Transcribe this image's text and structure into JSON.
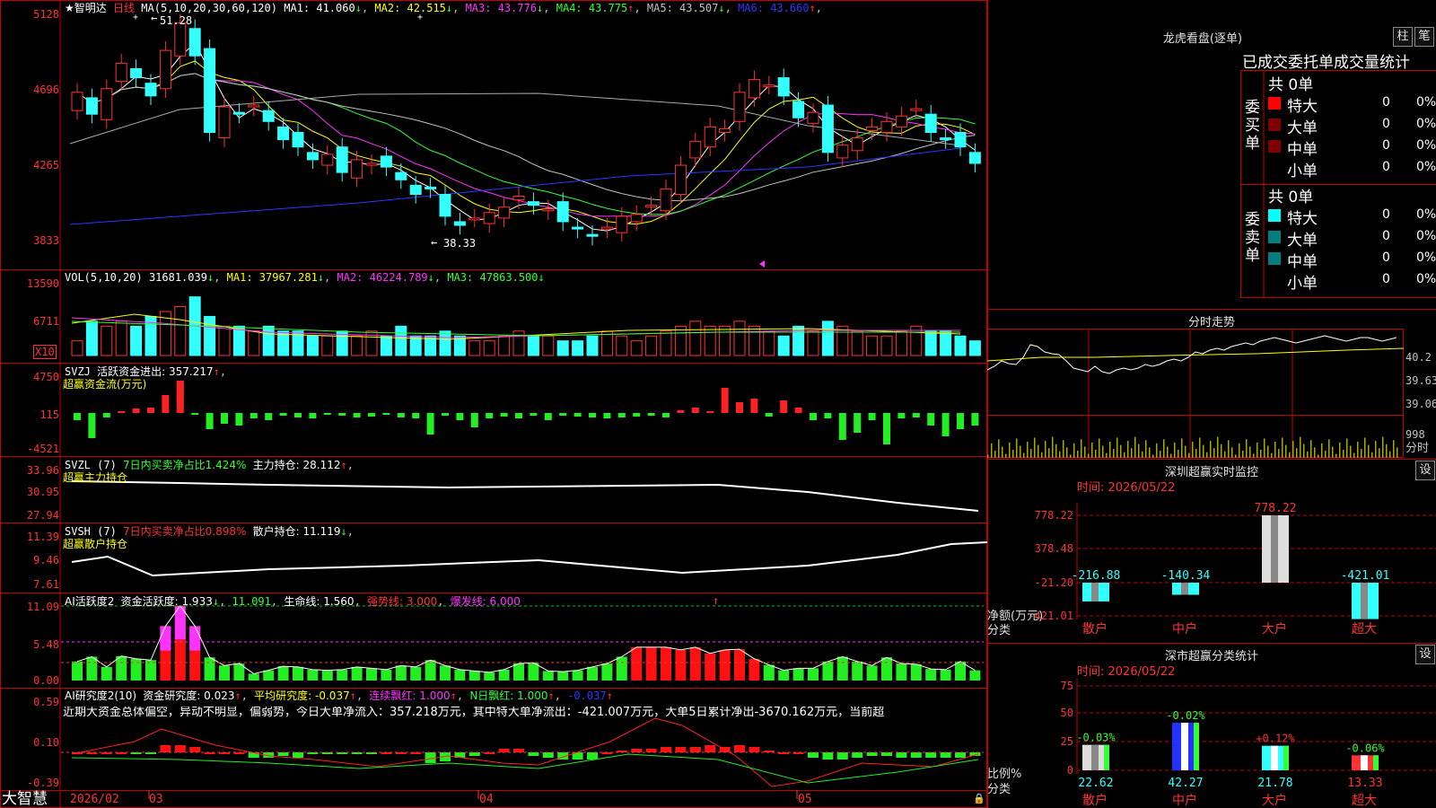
{
  "stock": {
    "name": "智明达",
    "period": "日线",
    "hi_label": "51.28",
    "lo_label": "38.33"
  },
  "kline_header": {
    "ma_def": "MA(5,10,20,30,60,120)",
    "items": [
      {
        "label": "MA1: 41.060",
        "arrow": "↓",
        "color": "#ffffff"
      },
      {
        "label": "MA2: 42.515",
        "arrow": "↓",
        "color": "#ffff00"
      },
      {
        "label": "MA3: 43.776",
        "arrow": "↓",
        "color": "#ff33ff"
      },
      {
        "label": "MA4: 43.775",
        "arrow": "↑",
        "color": "#33ff33"
      },
      {
        "label": "MA5: 43.507",
        "arrow": "↓",
        "color": "#c0c0c0"
      },
      {
        "label": "MA6: 43.660",
        "arrow": "↑",
        "color": "#3333ff"
      }
    ]
  },
  "price_axis": [
    "5128",
    "4696",
    "4265",
    "3833"
  ],
  "vol": {
    "header": "VOL(5,10,20)",
    "val": "31681.039",
    "ma1": "MA1: 37967.281",
    "ma2": "MA2: 46224.789",
    "ma3": "MA3: 47863.500",
    "axis": [
      "13590",
      "6711"
    ],
    "unit": "X10"
  },
  "svzj": {
    "name": "SVZJ",
    "label": "活跃资金进出: 357.217",
    "arrow": "↑",
    "sub": "超赢资金流(万元)",
    "axis": [
      "4750",
      "115",
      "-4521"
    ]
  },
  "svzl": {
    "name": "SVZL (7)",
    "label1": "7日内买卖净占比1.424%",
    "label2": "主力持仓: 28.112",
    "arrow": "↑",
    "sub": "超赢主力持仓",
    "axis": [
      "33.96",
      "30.95",
      "27.94"
    ]
  },
  "svsh": {
    "name": "SVSH (7)",
    "label1": "7日内买卖净占比0.898%",
    "label2": "散户持仓: 11.119",
    "arrow": "↓",
    "sub": "超赢散户持仓",
    "axis": [
      "11.39",
      "9.46",
      "7.61"
    ]
  },
  "ai_act": {
    "name": "AI活跃度2",
    "l1": "资金活跃度: 1.933",
    "l2": "11.091",
    "l3": "生命线: 1.560",
    "l4": "强势线: 3.000",
    "l5": "爆发线: 6.000",
    "axis": [
      "11.09",
      "5.48",
      "0.00"
    ]
  },
  "ai_res": {
    "name": "AI研究度2(10)",
    "l1": "资金研究度: 0.023",
    "l2": "平均研究度: -0.037",
    "l3": "连续飘红: 1.000",
    "l4": "N日飘红: 1.000",
    "l5": "-0.037",
    "comment": "近期大资金总体偏空，异动不明显，偏弱势，今日大单净流入：357.218万元，其中特大单净流出：-421.007万元，大单5日累计净出-3670.162万元，当前超",
    "axis": [
      "0.59",
      "0.10",
      "-0.39"
    ]
  },
  "dates": {
    "first": "2026/02",
    "m3": "03",
    "m4": "04",
    "m5": "05"
  },
  "brand": "大智慧",
  "dragon": {
    "title": "龙虎看盘(逐单)",
    "btn1": "柱",
    "btn2": "笔",
    "head": "已成交委托单成交量统计",
    "buy": {
      "label": "委买单",
      "total": "共 0单",
      "rows": [
        {
          "name": "特大",
          "v": "0",
          "p": "0%",
          "color": "#ff0000"
        },
        {
          "name": "大单",
          "v": "0",
          "p": "0%",
          "color": "#800000"
        },
        {
          "name": "中单",
          "v": "0",
          "p": "0%",
          "color": "#800000"
        },
        {
          "name": "小单",
          "v": "0",
          "p": "0%",
          "color": "#000000"
        }
      ]
    },
    "sell": {
      "label": "委卖单",
      "total": "共 0单",
      "rows": [
        {
          "name": "特大",
          "v": "0",
          "p": "0%",
          "color": "#00ffff"
        },
        {
          "name": "大单",
          "v": "0",
          "p": "0%",
          "color": "#008080"
        },
        {
          "name": "中单",
          "v": "0",
          "p": "0%",
          "color": "#008080"
        },
        {
          "name": "小单",
          "v": "0",
          "p": "0%",
          "color": "#000000"
        }
      ]
    }
  },
  "intraday": {
    "title": "分时走势",
    "axis": [
      "40.2",
      "39.63",
      "39.06",
      "998",
      "分时"
    ]
  },
  "sz_monitor": {
    "title": "深圳超赢实时监控",
    "btn": "设",
    "time": "时间: 2026/05/22",
    "axis": [
      "778.22",
      "378.48",
      "-21.20",
      "-421.01"
    ],
    "ylabel": "净额(万元)",
    "xlabel": "分类",
    "cats": [
      "散户",
      "中户",
      "大户",
      "超大"
    ],
    "values": [
      -216.88,
      -140.34,
      778.22,
      -421.01
    ],
    "labels": [
      "-216.88",
      "-140.34",
      "778.22",
      "-421.01"
    ]
  },
  "sz_class": {
    "title": "深市超赢分类统计",
    "btn": "设",
    "time": "时间: 2026/05/22",
    "axis": [
      "75",
      "50",
      "25",
      "0"
    ],
    "ylabel": "比例%",
    "xlabel": "分类",
    "cats": [
      "散户",
      "中户",
      "大户",
      "超大"
    ],
    "values": [
      22.62,
      42.27,
      21.78,
      13.33
    ],
    "labels": [
      "22.62",
      "42.27",
      "21.78",
      "13.33"
    ],
    "changes": [
      "-0.03%",
      "-0.02%",
      "+0.12%",
      "-0.06%"
    ]
  }
}
